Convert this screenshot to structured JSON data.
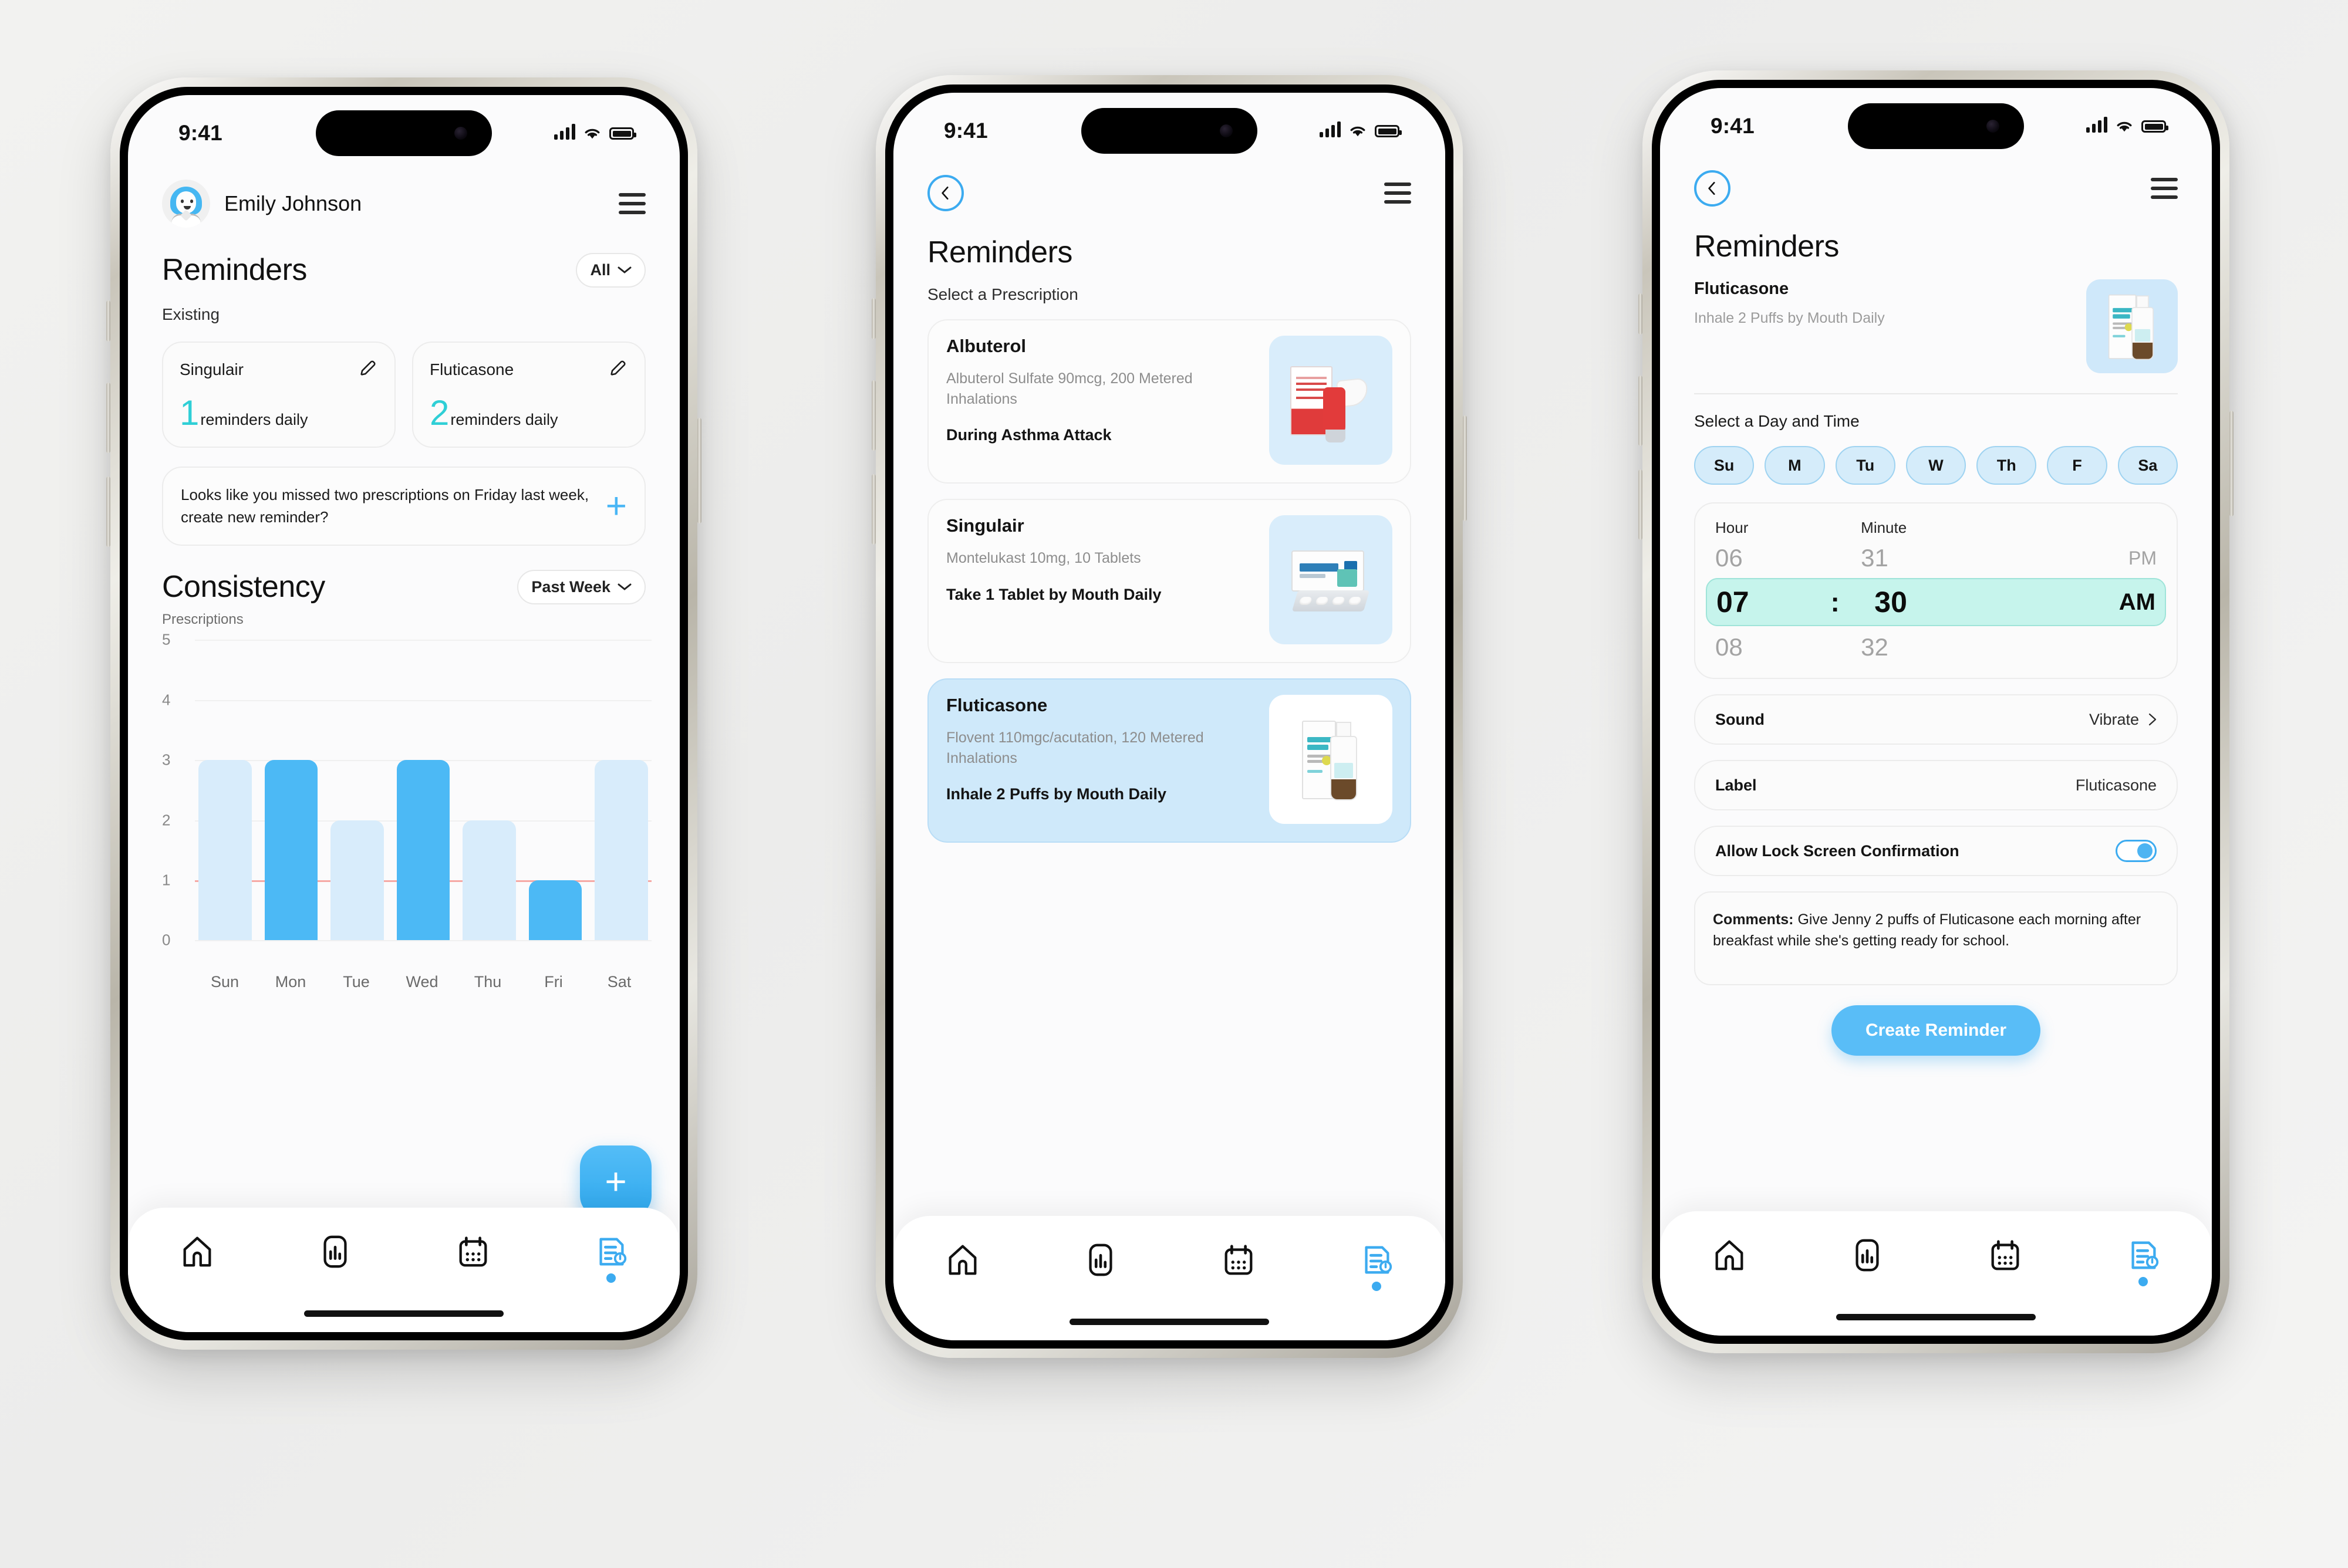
{
  "statusbar": {
    "time": "9:41"
  },
  "phone1": {
    "user": {
      "name": "Emily Johnson"
    },
    "page_title": "Reminders",
    "filter": {
      "label": "All"
    },
    "section_label": "Existing",
    "reminder_cards": [
      {
        "name": "Singulair",
        "count": "1",
        "unit": "reminders daily"
      },
      {
        "name": "Fluticasone",
        "count": "2",
        "unit": "reminders daily"
      }
    ],
    "alert": {
      "text": "Looks like you missed two prescriptions on Friday last week, create new reminder?",
      "action": "+"
    },
    "consistency": {
      "title": "Consistency",
      "range_label": "Past Week",
      "axis_caption": "Prescriptions"
    },
    "fab_label": "+"
  },
  "phone2": {
    "page_title": "Reminders",
    "section_label": "Select a Prescription",
    "prescriptions": [
      {
        "name": "Albuterol",
        "desc": "Albuterol Sulfate 90mcg, 200 Metered Inhalations",
        "directions": "During Asthma Attack",
        "image": "albuterol-inhaler-image",
        "selected": false
      },
      {
        "name": "Singulair",
        "desc": "Montelukast 10mg, 10 Tablets",
        "directions": "Take 1 Tablet by Mouth Daily",
        "image": "singulair-tablets-image",
        "selected": false
      },
      {
        "name": "Fluticasone",
        "desc": "Flovent 110mgc/acutation, 120 Metered Inhalations",
        "directions": "Inhale 2 Puffs by Mouth Daily",
        "image": "fluticasone-spray-image",
        "selected": true
      }
    ]
  },
  "phone3": {
    "page_title": "Reminders",
    "summary": {
      "name": "Fluticasone",
      "desc": "Inhale 2 Puffs by Mouth Daily",
      "image": "fluticasone-spray-image"
    },
    "day_time_label": "Select a Day and Time",
    "days": [
      "Su",
      "M",
      "Tu",
      "W",
      "Th",
      "F",
      "Sa"
    ],
    "time_picker": {
      "hour_header": "Hour",
      "minute_header": "Minute",
      "prev": {
        "hour": "06",
        "minute": "31",
        "period": "PM"
      },
      "selected": {
        "hour": "07",
        "separator": ":",
        "minute": "30",
        "period": "AM"
      },
      "next": {
        "hour": "08",
        "minute": "32"
      }
    },
    "settings": [
      {
        "key": "Sound",
        "value": "Vibrate"
      },
      {
        "key": "Label",
        "value": "Fluticasone"
      }
    ],
    "toggle_row": {
      "key": "Allow Lock Screen Confirmation",
      "state": "on"
    },
    "comments": {
      "prefix": "Comments:",
      "text": " Give Jenny 2 puffs of Fluticasone each morning after breakfast while she's getting ready for school."
    },
    "cta_label": "Create Reminder"
  },
  "bottom_nav": {
    "items": [
      {
        "icon": "home-icon",
        "active": false
      },
      {
        "icon": "bar-chart-icon",
        "active": false
      },
      {
        "icon": "calendar-icon",
        "active": false
      },
      {
        "icon": "reminder-bell-icon",
        "active": true
      }
    ]
  },
  "colors": {
    "accent_blue": "#4cb9f5",
    "light_blue": "#d8ecfb",
    "teal": "#2fcfd6",
    "selected_time": "#c6f4ec",
    "threshold_red": "#f6a9a5"
  },
  "chart_data": {
    "type": "bar",
    "title": "Consistency",
    "subtitle": "Past Week",
    "ylabel": "Prescriptions",
    "xlabel": "",
    "categories": [
      "Sun",
      "Mon",
      "Tue",
      "Wed",
      "Thu",
      "Fri",
      "Sat"
    ],
    "values": [
      3,
      3,
      2,
      3,
      2,
      1,
      3
    ],
    "bar_shades": [
      "light",
      "dark",
      "light",
      "dark",
      "light",
      "dark",
      "light"
    ],
    "ylim": [
      0,
      5
    ],
    "yticks": [
      0,
      1,
      2,
      3,
      4,
      5
    ],
    "grid": true,
    "threshold_line": 1,
    "legend": "none"
  }
}
